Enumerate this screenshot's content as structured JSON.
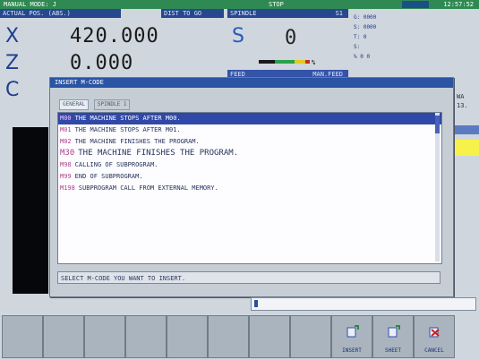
{
  "topbar": {
    "mode": "MANUAL MODE: J",
    "state": "STOP",
    "clock": "12:57:52"
  },
  "headers": {
    "actual_pos": "ACTUAL POS. (ABS.)",
    "dist_to_go": "DIST TO GO",
    "spindle": "SPINDLE",
    "spindle_no": "S1",
    "feed": "FEED",
    "feed_status": "MAN.FEED"
  },
  "axes": [
    {
      "name": "X",
      "value": "420.000"
    },
    {
      "name": "Z",
      "value": "0.000"
    },
    {
      "name": "C",
      "value": ""
    }
  ],
  "spindle_value": "0",
  "spindle_unit": "%",
  "right_info": [
    "G: 0000",
    "S: 0000",
    "T: 0",
    "S:",
    "% 0 0"
  ],
  "side_labels": [
    "WA",
    "13."
  ],
  "modal": {
    "title": "INSERT M-CODE",
    "tabs": [
      "GENERAL",
      "SPINDLE 1"
    ],
    "items": [
      {
        "code": "M00",
        "text": "THE MACHINE STOPS AFTER M00.",
        "selected": true
      },
      {
        "code": "M01",
        "text": "THE MACHINE STOPS AFTER M01.",
        "selected": false
      },
      {
        "code": "M02",
        "text": "THE MACHINE FINISHES THE PROGRAM.",
        "selected": false
      },
      {
        "code": "M30",
        "text": "THE MACHINE FINISHES THE PROGRAM.",
        "selected": false
      },
      {
        "code": "M98",
        "text": "CALLING OF SUBPROGRAM.",
        "selected": false
      },
      {
        "code": "M99",
        "text": "END OF SUBPROGRAM.",
        "selected": false
      },
      {
        "code": "M198",
        "text": "SUBPROGRAM CALL FROM EXTERNAL MEMORY.",
        "selected": false
      }
    ],
    "hint": "SELECT M-CODE YOU WANT TO INSERT."
  },
  "softkeys": [
    {
      "label": ""
    },
    {
      "label": ""
    },
    {
      "label": ""
    },
    {
      "label": ""
    },
    {
      "label": ""
    },
    {
      "label": ""
    },
    {
      "label": ""
    },
    {
      "label": ""
    },
    {
      "label": "INSERT",
      "icon": "insert-icon"
    },
    {
      "label": "SHEET",
      "icon": "sheet-icon"
    },
    {
      "label": "CANCEL",
      "icon": "cancel-icon"
    }
  ],
  "colors": {
    "accent": "#2b54a3",
    "highlight": "#3048a8",
    "topbar": "#2e8a52"
  }
}
